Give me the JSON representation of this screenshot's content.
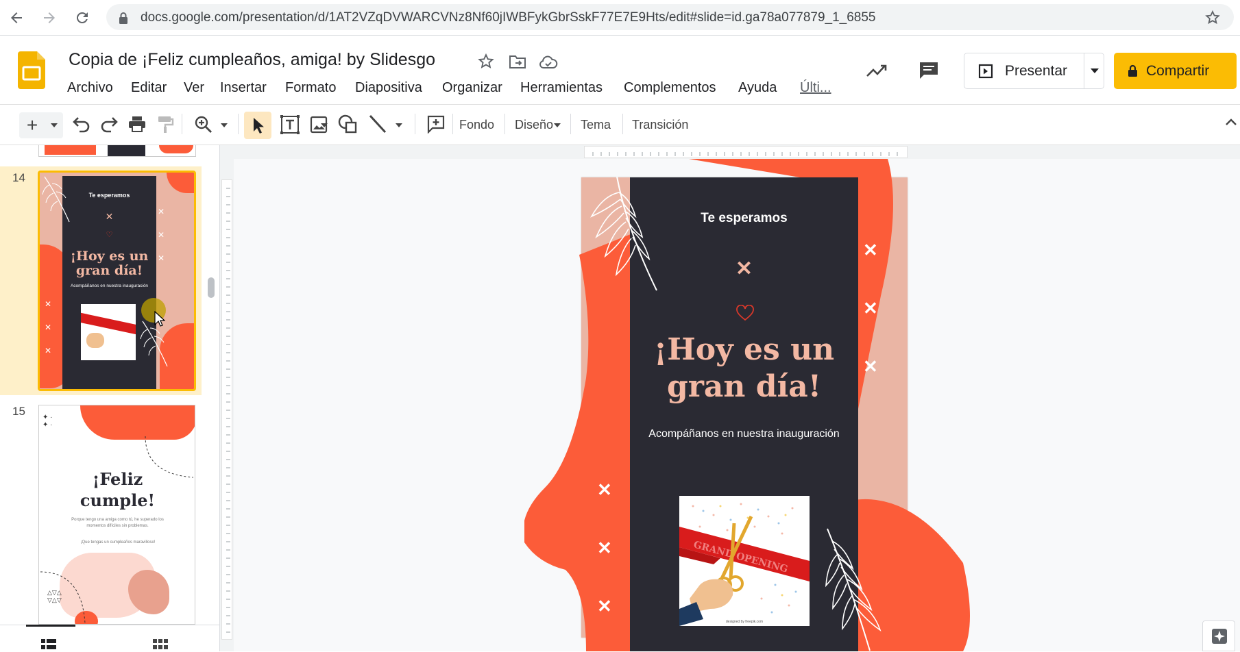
{
  "browser": {
    "url": "docs.google.com/presentation/d/1AT2VZqDVWARCVNz8Nf60jIWBFykGbrSskF77E7E9Hts/edit#slide=id.ga78a077879_1_6855"
  },
  "app": {
    "title": "Copia de ¡Feliz cumpleaños, amiga! by Slidesgo",
    "menu": [
      "Archivo",
      "Editar",
      "Ver",
      "Insertar",
      "Formato",
      "Diapositiva",
      "Organizar",
      "Herramientas",
      "Complementos",
      "Ayuda",
      "Últi..."
    ],
    "present_label": "Presentar",
    "share_label": "Compartir"
  },
  "toolbar": {
    "fondo": "Fondo",
    "diseno": "Diseño",
    "tema": "Tema",
    "transicion": "Transición"
  },
  "filmstrip": {
    "slide14": {
      "number": "14",
      "top_text": "Te esperamos",
      "headline": "¡Hoy es un gran día!",
      "subtitle": "Acompáñanos en nuestra inauguración",
      "credit": "designed by freepik.com"
    },
    "slide15": {
      "number": "15",
      "headline_1": "¡Feliz",
      "headline_2": "cumple!",
      "body_1": "Porque tengo una amiga como tú, he superado los momentos difíciles sin problemas.",
      "body_2": "¡Que tengas un cumpleaños maravilloso!"
    }
  },
  "slide": {
    "top_text": "Te esperamos",
    "headline_1": "¡Hoy es un",
    "headline_2": "gran día!",
    "subtitle": "Acompáñanos en nuestra inauguración",
    "image_banner": "GRAND OPENING",
    "image_credit": "designed by freepik.com"
  },
  "colors": {
    "accent_yellow": "#fbbc04",
    "slide_dark": "#2a2a33",
    "slide_orange": "#fc5c39",
    "slide_pink": "#eab5a4",
    "headline": "#f3b8a3"
  }
}
